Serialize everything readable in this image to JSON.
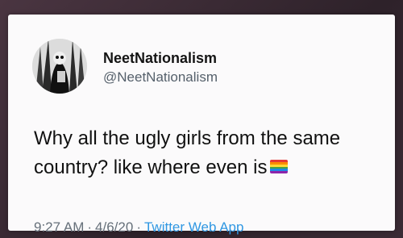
{
  "tweet": {
    "display_name": "NeetNationalism",
    "handle": "@NeetNationalism",
    "text_line1": "Why all the ugly girls from the same",
    "text_line2": "country? like where even is",
    "flag_icon": "rainbow-flag-emoji",
    "time": "9:27 AM",
    "separator": "·",
    "date": "4/6/20",
    "source": "Twitter Web App"
  },
  "colors": {
    "background": "#3a2a34",
    "card": "#fbfafb",
    "text": "#111111",
    "meta": "#66707a",
    "link": "#2f97e2"
  }
}
